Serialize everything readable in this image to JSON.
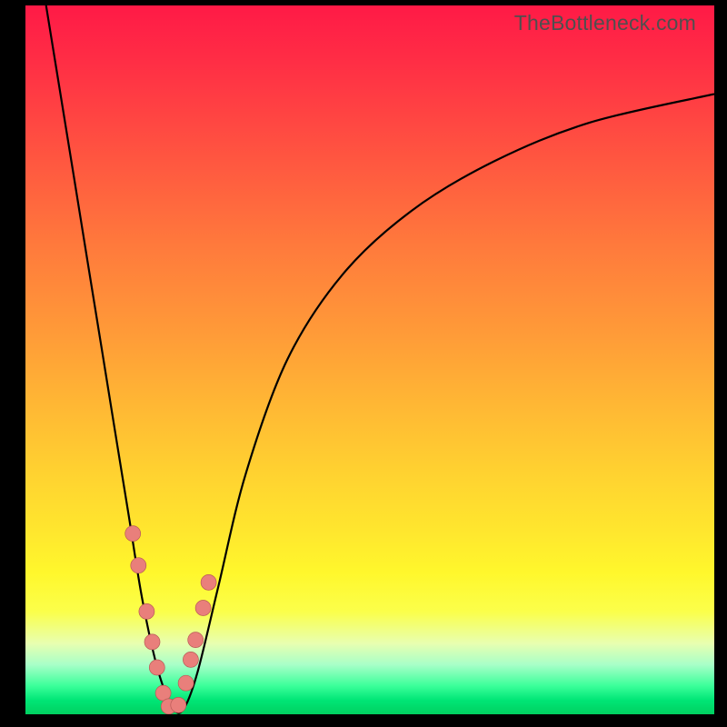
{
  "watermark": "TheBottleneck.com",
  "chart_data": {
    "type": "line",
    "title": "",
    "xlabel": "",
    "ylabel": "",
    "xlim": [
      0,
      100
    ],
    "ylim": [
      0,
      100
    ],
    "series": [
      {
        "name": "bottleneck-curve",
        "x": [
          3,
          5,
          7,
          9,
          11,
          13,
          15,
          17,
          19.3,
          21.5,
          23,
          25,
          28,
          32,
          38,
          46,
          56,
          68,
          82,
          100
        ],
        "values": [
          100,
          88,
          76,
          64,
          52,
          40,
          28,
          16,
          6,
          0.8,
          0.8,
          6,
          18,
          34,
          50,
          62,
          71,
          78,
          83.5,
          87.5
        ]
      }
    ],
    "markers": {
      "name": "highlight-beads",
      "x": [
        15.6,
        16.4,
        17.6,
        18.4,
        19.1,
        20.0,
        20.8,
        22.2,
        23.3,
        24.0,
        24.7,
        25.8,
        26.6
      ],
      "values": [
        25.5,
        21.0,
        14.5,
        10.2,
        6.6,
        3.0,
        1.1,
        1.3,
        4.4,
        7.7,
        10.5,
        15.0,
        18.6
      ]
    },
    "background": {
      "type": "vertical-gradient",
      "stops": [
        {
          "pos": 0.0,
          "color": "#ff1a46"
        },
        {
          "pos": 0.5,
          "color": "#ffb236"
        },
        {
          "pos": 0.8,
          "color": "#fff72c"
        },
        {
          "pos": 0.96,
          "color": "#3bff9a"
        },
        {
          "pos": 1.0,
          "color": "#00d060"
        }
      ]
    }
  }
}
